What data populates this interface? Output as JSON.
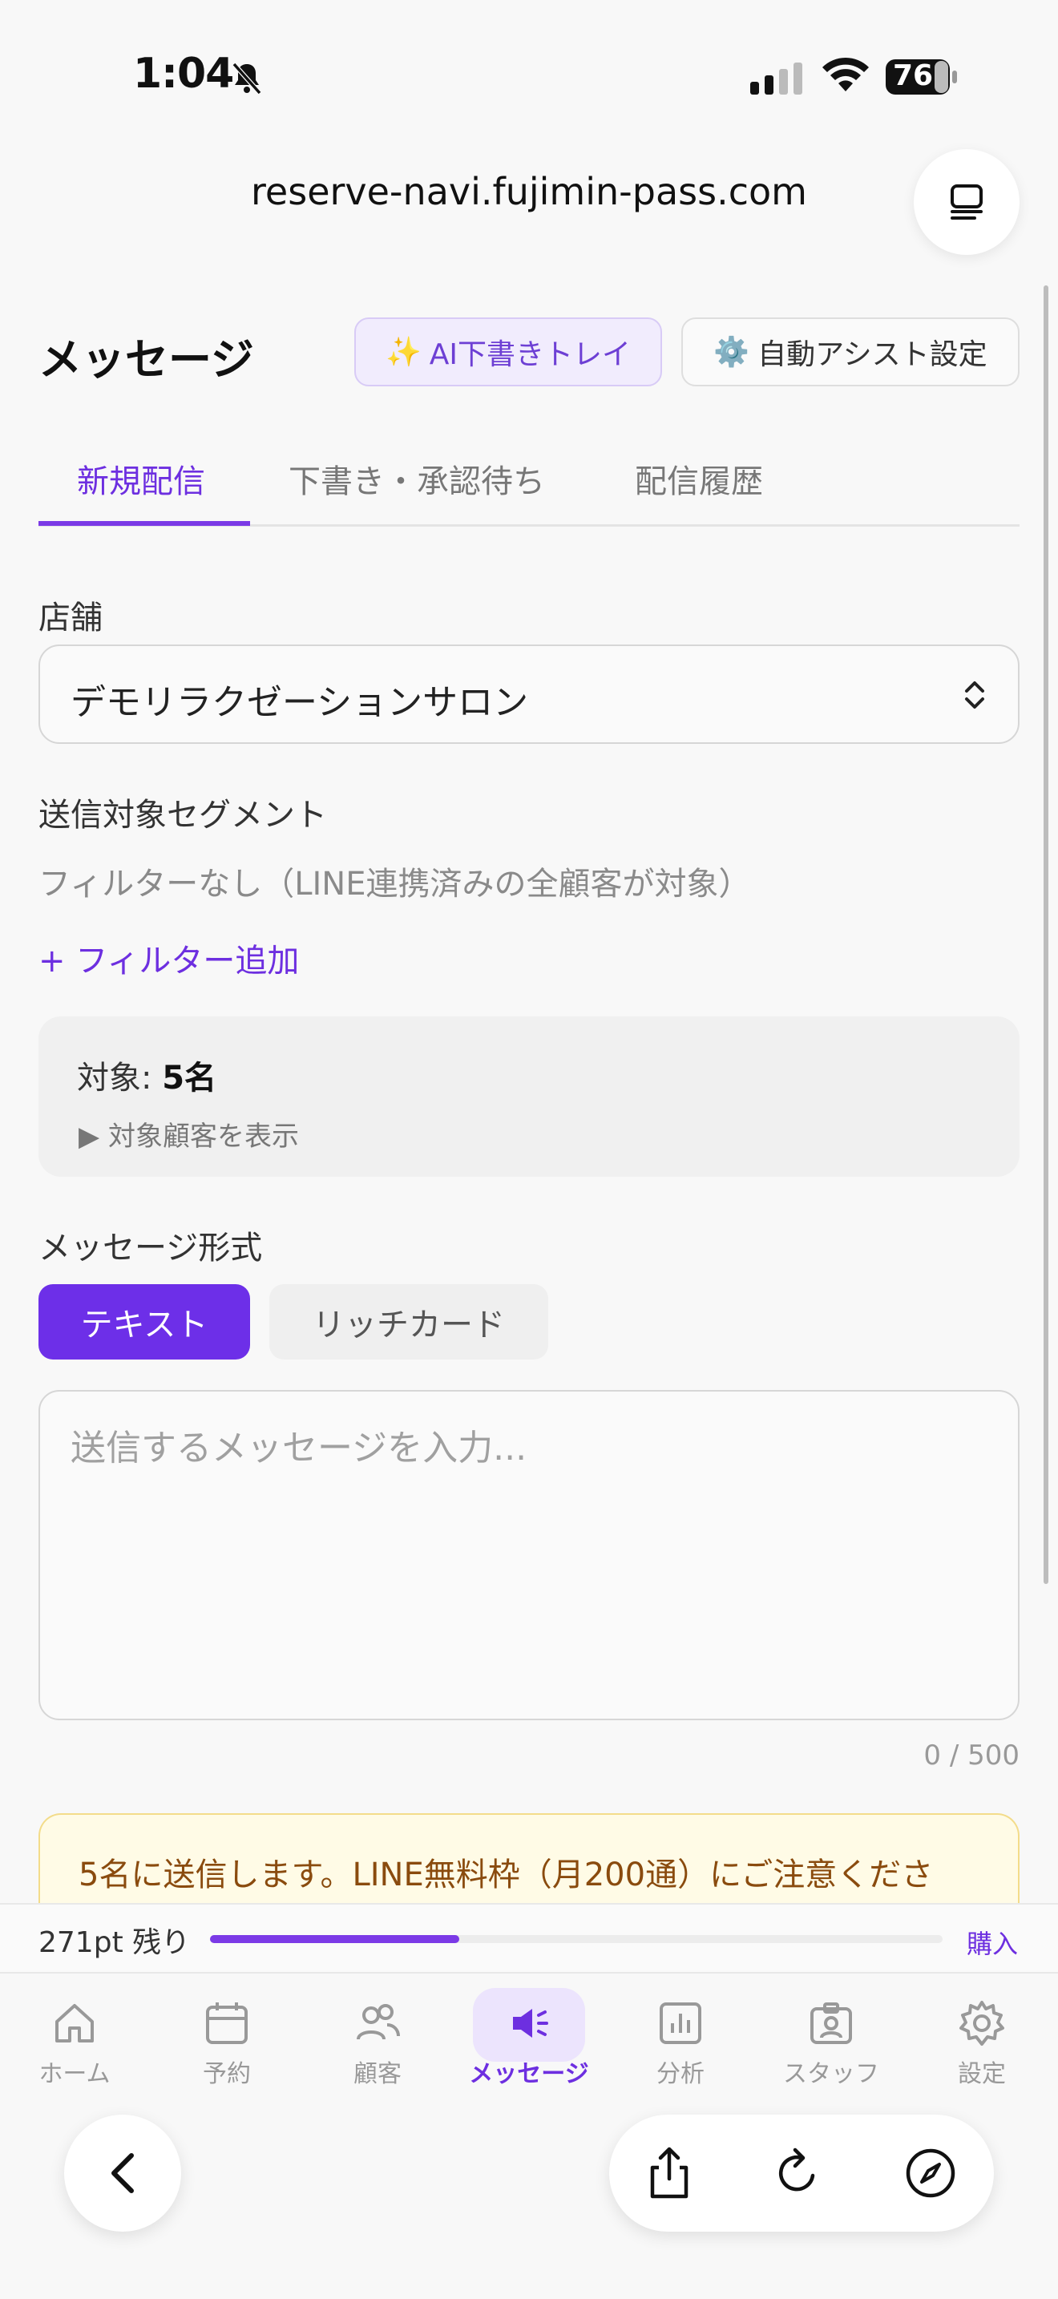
{
  "status_bar": {
    "time": "1:04",
    "battery": "76"
  },
  "browser": {
    "url": "reserve-navi.fujimin-pass.com"
  },
  "page": {
    "title": "メッセージ",
    "ai_button": "AI下書きトレイ",
    "ai_button_icon": "✨",
    "assist_button": "自動アシスト設定",
    "assist_button_icon": "⚙️"
  },
  "tabs": [
    {
      "label": "新規配信",
      "active": true
    },
    {
      "label": "下書き・承認待ち",
      "active": false
    },
    {
      "label": "配信履歴",
      "active": false
    }
  ],
  "form": {
    "store_label": "店舗",
    "store_value": "デモリラクゼーションサロン",
    "segment_label": "送信対象セグメント",
    "segment_desc": "フィルターなし（LINE連携済みの全顧客が対象）",
    "add_filter": "+ フィルター追加",
    "target_prefix": "対象: ",
    "target_count": "5名",
    "target_toggle": "▶ 対象顧客を表示",
    "format_label": "メッセージ形式",
    "format_text": "テキスト",
    "format_rich": "リッチカード",
    "message_placeholder": "送信するメッセージを入力...",
    "message_value": "",
    "char_counter": "0 / 500",
    "warning": "5名に送信します。LINE無料枠（月200通）にご注意くださ"
  },
  "points": {
    "label": "271pt 残り",
    "fill_fraction": 0.34,
    "buy": "購入"
  },
  "nav": [
    {
      "label": "ホーム",
      "icon": "home-icon"
    },
    {
      "label": "予約",
      "icon": "calendar-icon"
    },
    {
      "label": "顧客",
      "icon": "users-icon"
    },
    {
      "label": "メッセージ",
      "icon": "megaphone-icon",
      "active": true
    },
    {
      "label": "分析",
      "icon": "chart-icon"
    },
    {
      "label": "スタッフ",
      "icon": "badge-icon"
    },
    {
      "label": "設定",
      "icon": "gear-icon"
    }
  ],
  "colors": {
    "accent": "#6d2fe0",
    "warning_bg": "#fffbe6",
    "warning_text": "#8a4b0e"
  }
}
